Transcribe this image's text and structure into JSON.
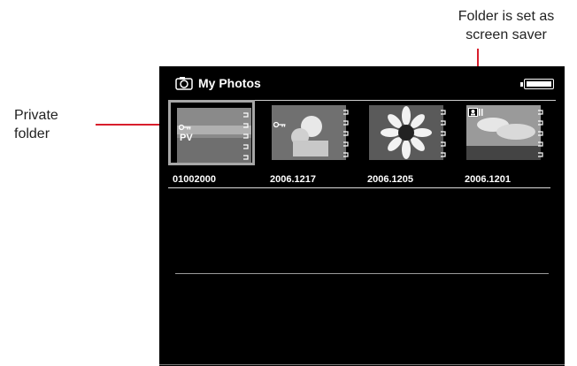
{
  "callouts": {
    "private_folder": [
      "Private",
      "folder"
    ],
    "screen_saver": [
      "Folder is set as",
      "screen saver"
    ]
  },
  "header": {
    "title": "My Photos",
    "camera_icon": "camera-icon",
    "battery_icon": "battery-icon"
  },
  "folders": [
    {
      "caption": "01002000",
      "badge": "PV",
      "selected": true,
      "icon": "key-icon"
    },
    {
      "caption": "2006.1217",
      "badge": "",
      "selected": false,
      "icon": "key-icon"
    },
    {
      "caption": "2006.1205",
      "badge": "",
      "selected": false,
      "icon": ""
    },
    {
      "caption": "2006.1201",
      "badge": "",
      "selected": false,
      "icon": "screensaver-icon"
    }
  ],
  "colors": {
    "screen_background": "#000000",
    "leader_line": "#d81e2c",
    "selection_border": "#a7a7a7"
  }
}
